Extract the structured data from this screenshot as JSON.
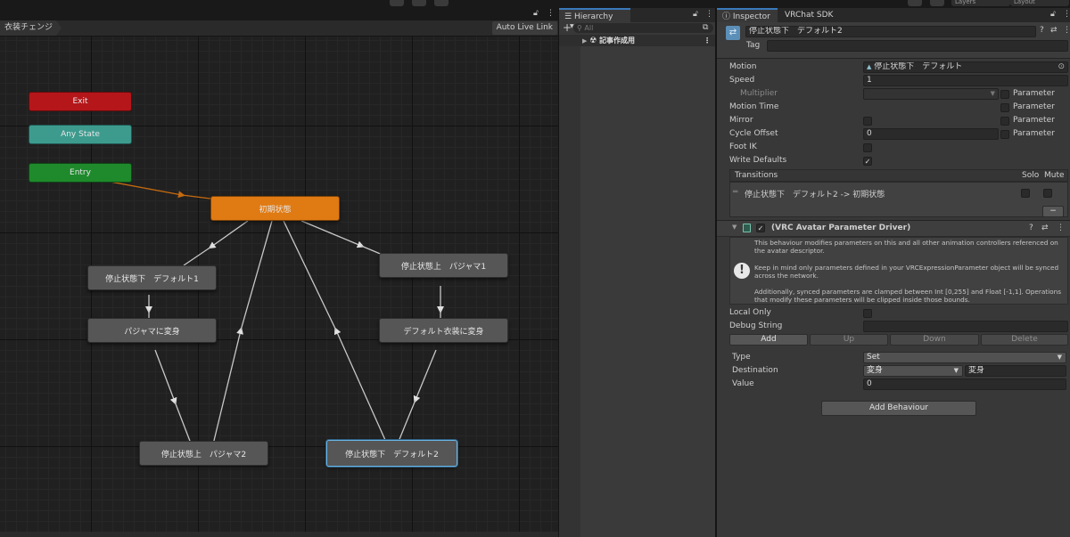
{
  "toolbar": {
    "layers_label": "Layers",
    "layout_label": "Layout"
  },
  "animator": {
    "breadcrumb": "衣装チェンジ",
    "live_link": "Auto Live Link",
    "nodes": {
      "exit": "Exit",
      "any_state": "Any State",
      "entry": "Entry",
      "initial": "初期状態",
      "stop_down_default1": "停止状態下　デフォルト1",
      "to_pajama": "パジャマに変身",
      "stop_up_pajama2": "停止状態上　パジャマ2",
      "stop_up_pajama1": "停止状態上　パジャマ1",
      "to_default": "デフォルト衣装に変身",
      "stop_down_default2": "停止状態下　デフォルト2"
    },
    "colors": {
      "exit": "#b5161a",
      "any_state": "#3d9b8e",
      "entry": "#1f8a2c",
      "default_state": "#e07a12",
      "link": "#c8c8c8",
      "entry_link": "#c66a10"
    }
  },
  "hierarchy": {
    "tab": "Hierarchy",
    "search_placeholder": "All",
    "scene": "記事作成用"
  },
  "inspector": {
    "tabs": [
      "Inspector",
      "VRChat SDK"
    ],
    "object_name": "停止状態下　デフォルト2",
    "tag_label": "Tag",
    "rows": {
      "motion_label": "Motion",
      "motion_value": "停止状態下　デフォルト",
      "speed_label": "Speed",
      "speed_value": "1",
      "multiplier_label": "Multiplier",
      "motion_time_label": "Motion Time",
      "mirror_label": "Mirror",
      "cycle_offset_label": "Cycle Offset",
      "cycle_offset_value": "0",
      "foot_ik_label": "Foot IK",
      "write_defaults_label": "Write Defaults",
      "parameter_label": "Parameter"
    },
    "transitions": {
      "header": "Transitions",
      "solo": "Solo",
      "mute": "Mute",
      "item": "停止状態下　デフォルト2 -> 初期状態",
      "remove": "−"
    },
    "behaviour": {
      "title": "(VRC Avatar Parameter Driver)",
      "help_lines": [
        "This behaviour modifies parameters on this and all other animation controllers referenced on",
        "the avatar descriptor.",
        "Keep in mind only parameters defined in your VRCExpressionParameter object will be synced",
        "across the network.",
        "Additionally, synced parameters are clamped between Int [0,255] and Float [-1,1]. Operations",
        "that modify these parameters will be clipped inside those bounds."
      ],
      "local_only_label": "Local Only",
      "debug_string_label": "Debug String",
      "buttons": [
        "Add",
        "Up",
        "Down",
        "Delete"
      ],
      "type_label": "Type",
      "type_value": "Set",
      "destination_label": "Destination",
      "destination_value": "変身",
      "destination_text": "変身",
      "value_label": "Value",
      "value_value": "0"
    },
    "add_behaviour": "Add Behaviour"
  }
}
